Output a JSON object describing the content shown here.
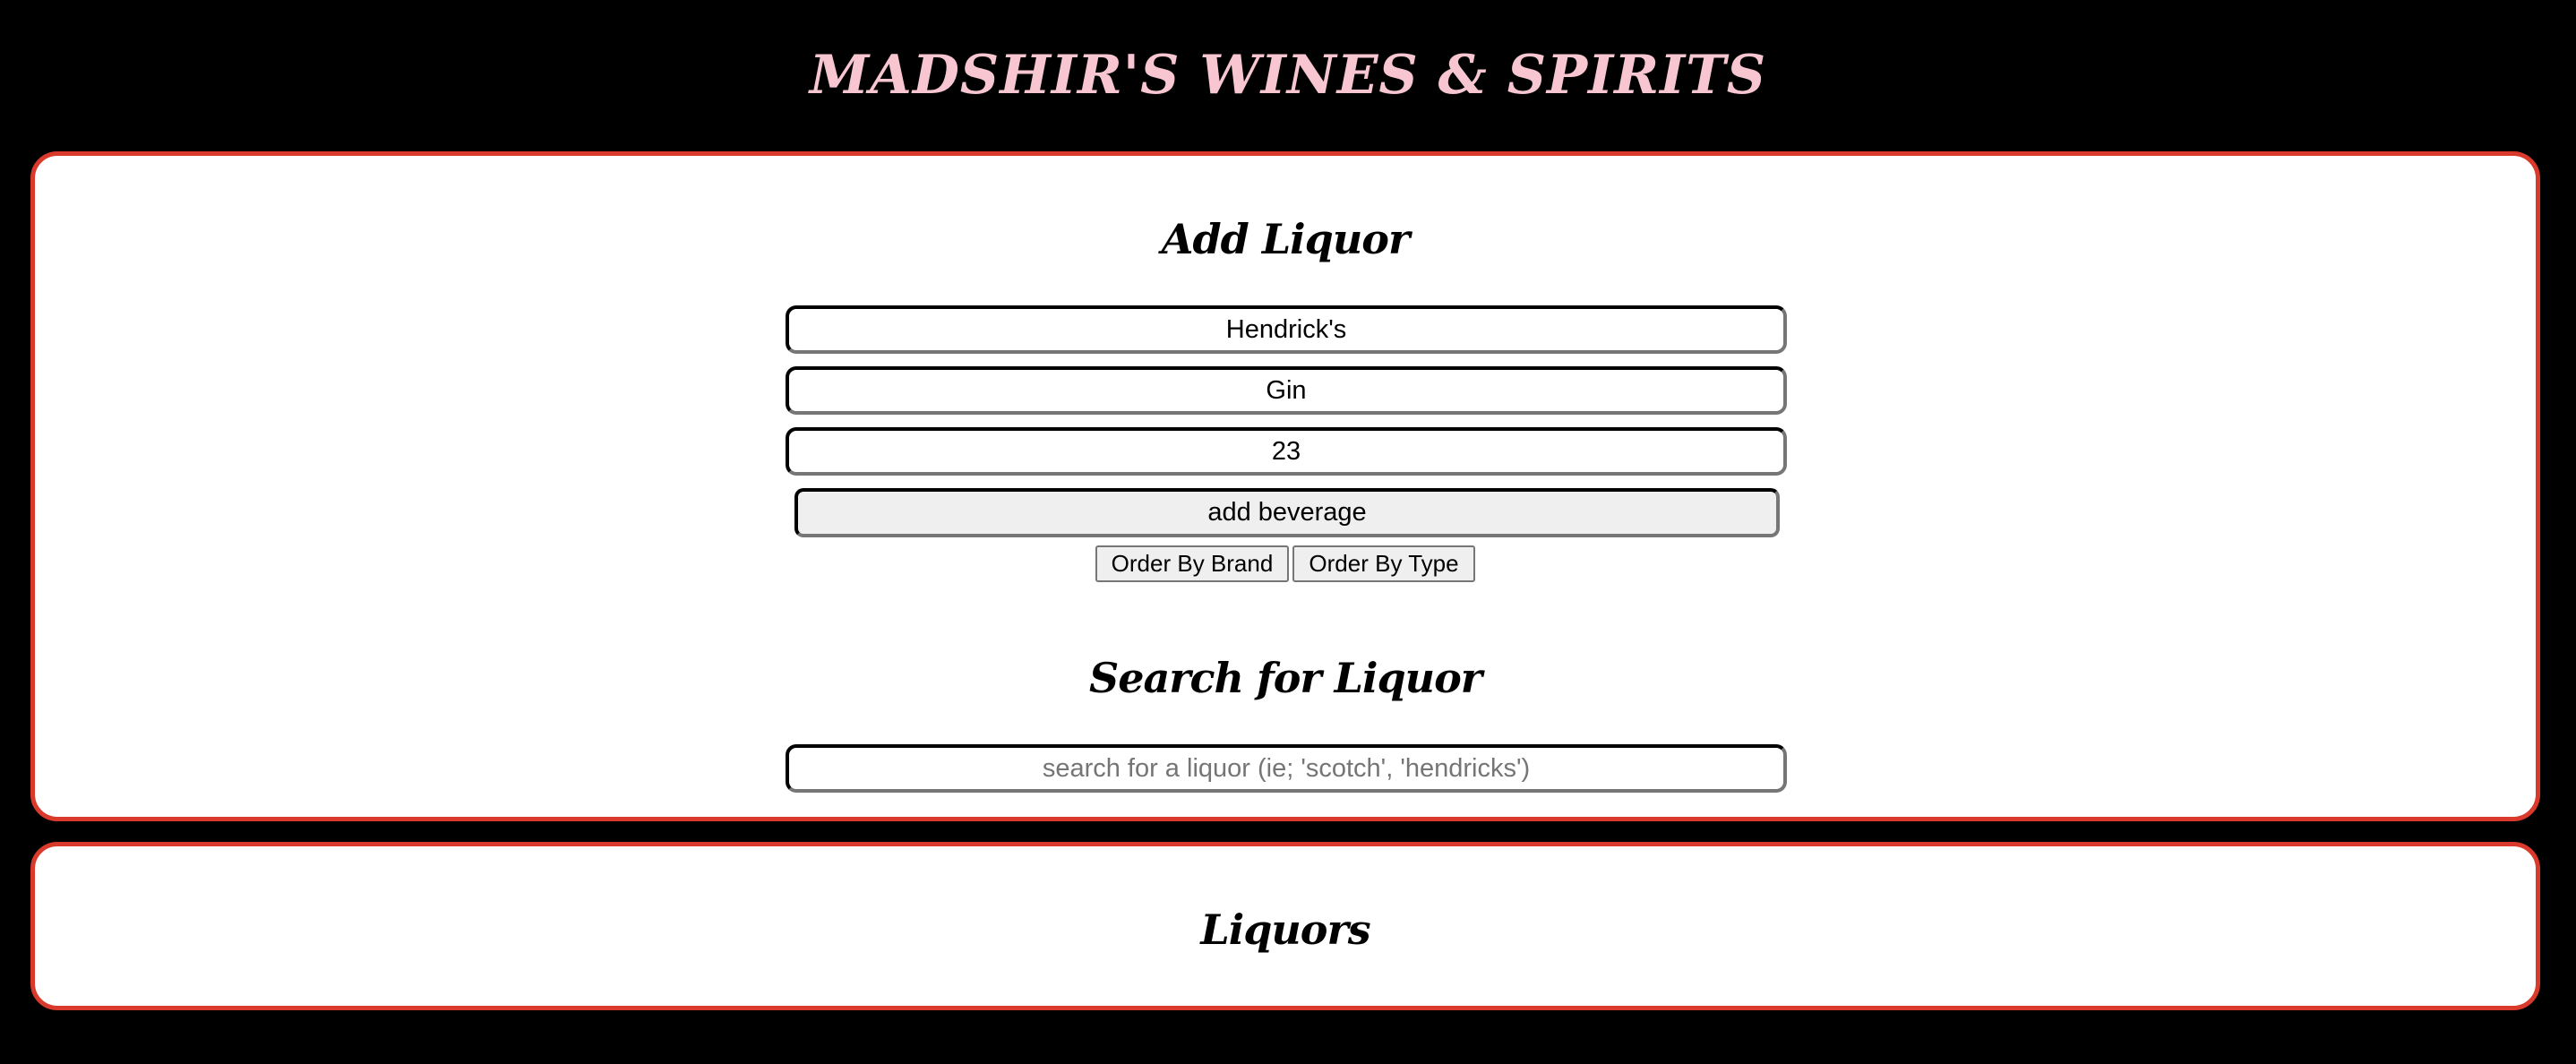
{
  "header": {
    "title": "MADSHIR'S WINES & SPIRITS",
    "title_color": "#f7c6d1"
  },
  "theme": {
    "background": "#000000",
    "panel_background": "#ffffff",
    "panel_border": "#d93a2c"
  },
  "add_form": {
    "heading": "Add Liquor",
    "brand_value": "Hendrick's",
    "type_value": "Gin",
    "price_value": "23",
    "submit_label": "add beverage",
    "order_by_brand_label": "Order By Brand",
    "order_by_type_label": "Order By Type"
  },
  "search": {
    "heading": "Search for Liquor",
    "value": "",
    "placeholder": "search for a liquor (ie; 'scotch', 'hendricks')"
  },
  "liquor_list": {
    "heading": "Liquors",
    "items": []
  }
}
